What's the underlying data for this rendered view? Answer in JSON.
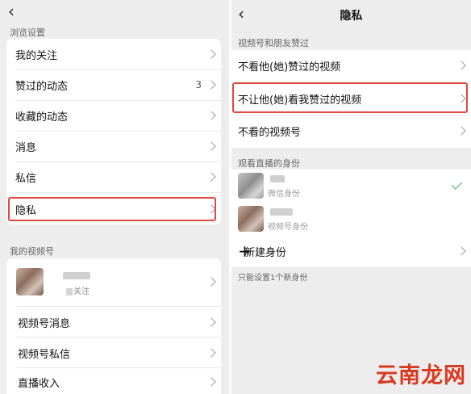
{
  "left": {
    "back_icon": "chevron-left-icon",
    "browse_section": "浏览设置",
    "browse_items": [
      {
        "label": "我的关注"
      },
      {
        "label": "赞过的动态",
        "count": "3"
      },
      {
        "label": "收藏的动态"
      },
      {
        "label": "消息"
      },
      {
        "label": "私信"
      },
      {
        "label": "隐私"
      }
    ],
    "channel_section": "我的视频号",
    "profile": {
      "follow_text": "关注"
    },
    "channel_items": [
      {
        "label": "视频号消息"
      },
      {
        "label": "视频号私信"
      },
      {
        "label": "直播收入"
      }
    ]
  },
  "right": {
    "back_icon": "chevron-left-icon",
    "title": "隐私",
    "liked_section": "视频号和朋友赞过",
    "liked_items": [
      {
        "label": "不看他(她)赞过的视频"
      },
      {
        "label": "不让他(她)看我赞过的视频"
      },
      {
        "label": "不看的视频号"
      }
    ],
    "identity_section": "观看直播的身份",
    "identities": [
      {
        "sub": "微信身份",
        "selected": true
      },
      {
        "sub": "视频号身份",
        "selected": false
      }
    ],
    "new_identity": "新建身份",
    "footnote": "只能设置1个新身份"
  },
  "watermark": "云南龙网",
  "colors": {
    "highlight": "#e0483e",
    "check": "#3db35a",
    "watermark": "#d8391f"
  }
}
